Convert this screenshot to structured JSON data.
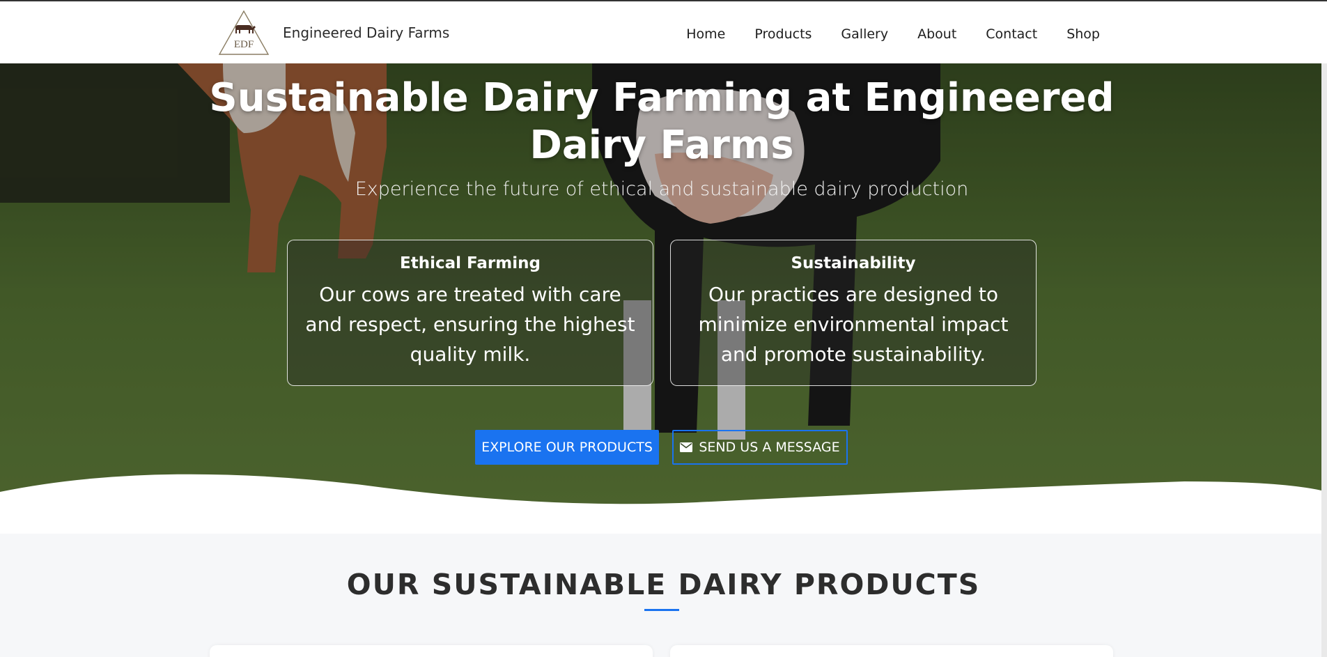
{
  "header": {
    "brand_name": "Engineered Dairy Farms",
    "logo_text": "EDF",
    "nav": [
      "Home",
      "Products",
      "Gallery",
      "About",
      "Contact",
      "Shop"
    ]
  },
  "hero": {
    "title": "Sustainable Dairy Farming at Engineered Dairy Farms",
    "subtitle": "Experience the future of ethical and sustainable dairy production",
    "cards": [
      {
        "title": "Ethical Farming",
        "text": "Our cows are treated with care and respect, ensuring the highest quality milk."
      },
      {
        "title": "Sustainability",
        "text": "Our practices are designed to minimize environmental impact and promote sustainability."
      }
    ],
    "primary_button": "Explore Our Products",
    "secondary_button": "Send Us A Message",
    "secondary_icon": "mail-icon"
  },
  "products": {
    "heading": "OUR SUSTAINABLE DAIRY PRODUCTS"
  },
  "colors": {
    "accent": "#1a73f0",
    "grass": "#5c7f3b"
  }
}
